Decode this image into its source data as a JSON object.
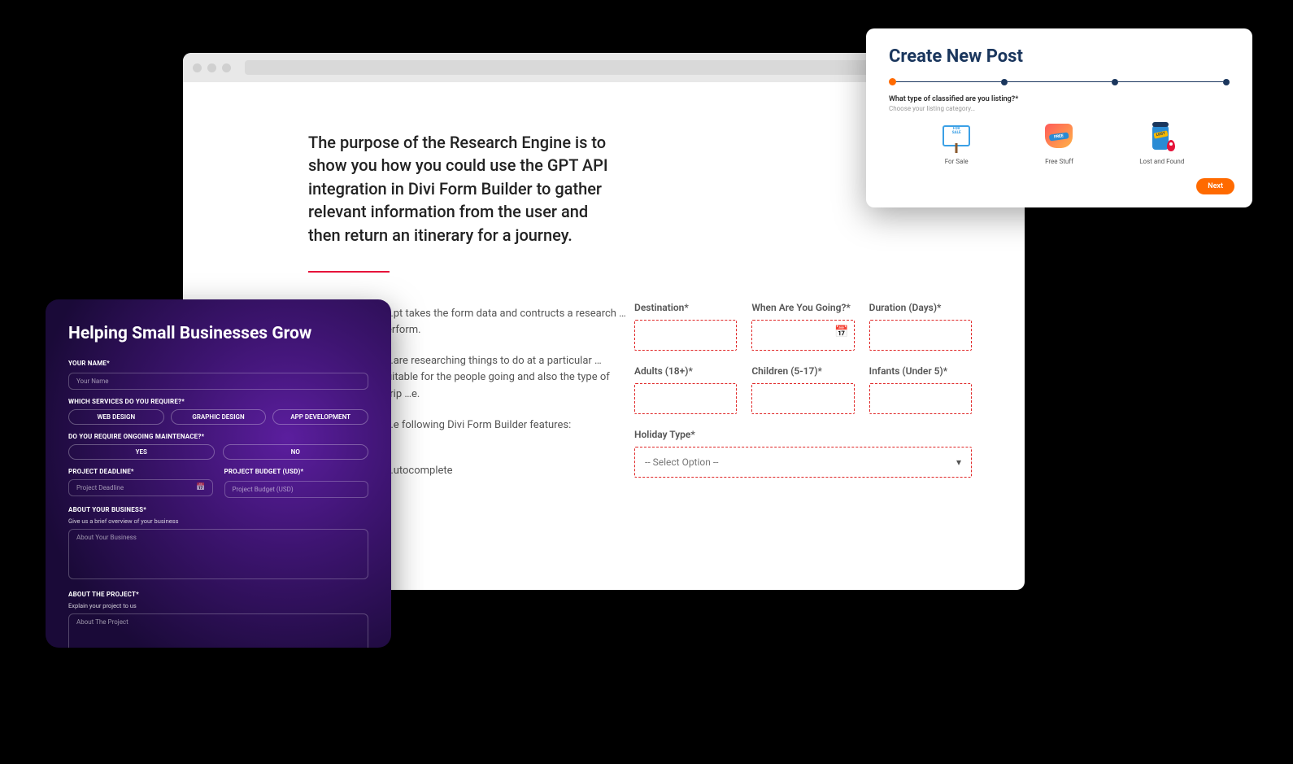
{
  "browser": {
    "intro": "The purpose of the Research Engine is to show you how you could use the GPT API integration in Divi Form Builder to gather relevant information from the user and then return an itinerary for a journey.",
    "desc1": "…pt takes the form data and contructs a research …erform.",
    "desc2": "…are researching things to do at a particular …uitable for the people going and also the type of trip …e.",
    "desc3": "…e following Divi Form Builder features:",
    "desc4": "…utocomplete",
    "form": {
      "destination": "Destination*",
      "when": "When Are You Going?*",
      "duration": "Duration (Days)*",
      "adults": "Adults (18+)*",
      "children": "Children (5-17)*",
      "infants": "Infants (Under 5)*",
      "holiday_type": "Holiday Type*",
      "select_placeholder": "-- Select Option --"
    }
  },
  "purple": {
    "title": "Helping Small Businesses Grow",
    "your_name_label": "YOUR NAME*",
    "your_name_ph": "Your Name",
    "services_label": "WHICH SERVICES DO YOU REQUIRE?*",
    "services": [
      "WEB DESIGN",
      "GRAPHIC DESIGN",
      "APP DEVELOPMENT"
    ],
    "maint_label": "DO YOU REQUIRE ONGOING MAINTENACE?*",
    "maint_options": [
      "YES",
      "NO"
    ],
    "deadline_label": "PROJECT DEADLINE*",
    "deadline_ph": "Project Deadline",
    "budget_label": "PROJECT BUDGET (USD)*",
    "budget_ph": "Project Budget (USD)",
    "about_biz_label": "ABOUT YOUR BUSINESS*",
    "about_biz_sub": "Give us a brief overview of your business",
    "about_biz_ph": "About Your Business",
    "about_proj_label": "ABOUT THE PROJECT*",
    "about_proj_sub": "Explain your project to us",
    "about_proj_ph": "About The Project"
  },
  "post": {
    "title": "Create New Post",
    "question": "What type of classified are you listing?*",
    "subtext": "Choose your listing category…",
    "cats": [
      {
        "label": "For Sale",
        "sign_top": "FOR",
        "sign_bottom": "SALE"
      },
      {
        "label": "Free Stuff",
        "band": "FREE"
      },
      {
        "label": "Lost and Found",
        "tag": "LOST"
      }
    ],
    "next": "Next",
    "steps": 4,
    "active_step": 1
  }
}
